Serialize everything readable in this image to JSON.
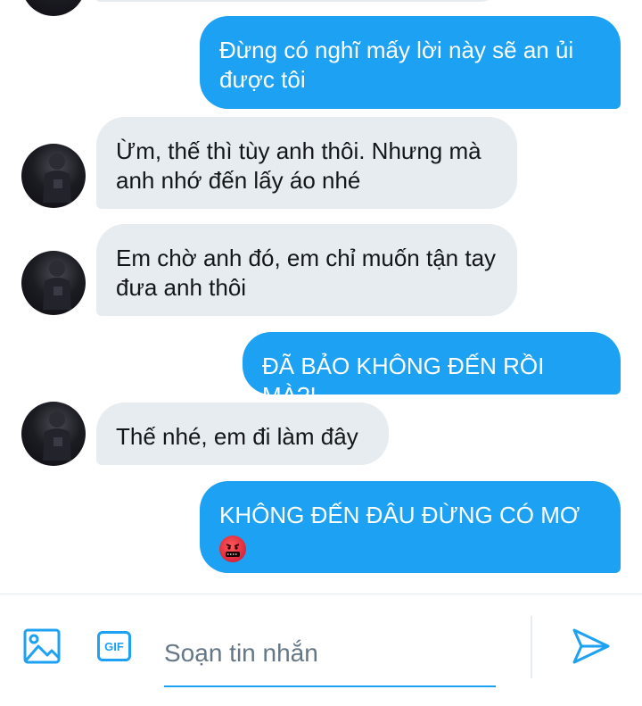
{
  "messages": [
    {
      "direction": "outgoing",
      "text": "Đừng có nghĩ mấy lời này sẽ an ủi được tôi"
    },
    {
      "direction": "incoming",
      "text": "Ừm, thế thì tùy anh thôi. Nhưng mà anh nhớ đến lấy áo nhé"
    },
    {
      "direction": "incoming",
      "text": "Em chờ anh đó, em chỉ muốn tận tay đưa anh thôi"
    },
    {
      "direction": "outgoing",
      "text": "ĐÃ BẢO KHÔNG ĐẾN RỒI MÀ?!"
    },
    {
      "direction": "incoming",
      "text": "Thế nhé, em đi làm đây"
    },
    {
      "direction": "outgoing",
      "text": "KHÔNG ĐẾN ĐÂU ĐỪNG CÓ MƠ",
      "emoji": "angry-face-with-symbols"
    }
  ],
  "composer": {
    "placeholder": "Soạn tin nhắn",
    "value": "",
    "gif_label": "GIF",
    "icons": {
      "media": "image-icon",
      "gif": "gif-icon",
      "send": "send-icon"
    }
  },
  "colors": {
    "accent": "#1da1f2",
    "incoming_bubble": "#e6ecf0",
    "text_dark": "#14171a",
    "placeholder": "#657786"
  }
}
